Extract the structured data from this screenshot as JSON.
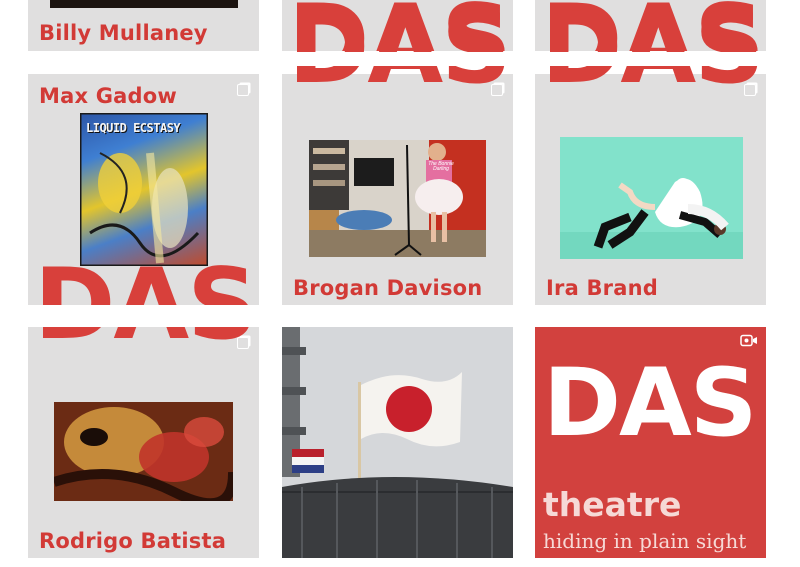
{
  "tiles": [
    {
      "name": "Billy Mullaney"
    },
    {
      "name": "Max Gadow"
    },
    {
      "name": "Brogan Davison"
    },
    {
      "name": "Ira Brand"
    },
    {
      "name": "Rodrigo Batista"
    }
  ],
  "brand": {
    "das": "DAS",
    "theatre": "theatre",
    "tagline": "hiding in plain sight"
  },
  "artwork": {
    "poster_title": "LIQUID ECSTASY",
    "shirt_text": "The Bonnie Darling"
  },
  "icons": {
    "multi": "multiple-posts-icon",
    "video": "video-camera-icon"
  },
  "colors": {
    "tile_bg": "#e0dfdf",
    "accent_red": "#d2413e",
    "text_red": "#d23a36"
  }
}
